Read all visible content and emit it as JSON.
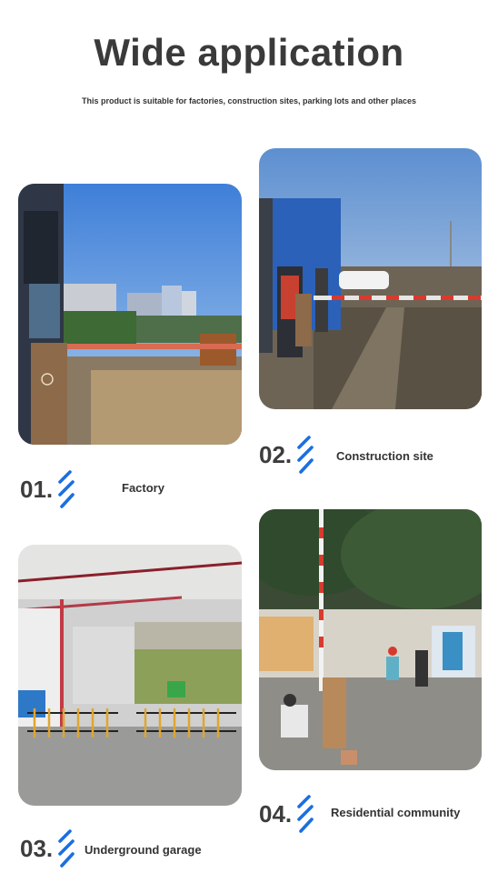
{
  "header": {
    "title": "Wide application",
    "subtitle": "This product is suitable for factories, construction sites, parking lots and other places"
  },
  "items": [
    {
      "number": "01.",
      "label": "Factory"
    },
    {
      "number": "02.",
      "label": "Construction site"
    },
    {
      "number": "03.",
      "label": "Underground garage"
    },
    {
      "number": "04.",
      "label": "Residential community"
    }
  ],
  "colors": {
    "accent": "#1b6fe0",
    "title": "#3a3a3a",
    "barrier_red": "#d83a2e",
    "post_brown": "#8c6a4a"
  },
  "icons": [
    "slash-stripes-icon"
  ]
}
